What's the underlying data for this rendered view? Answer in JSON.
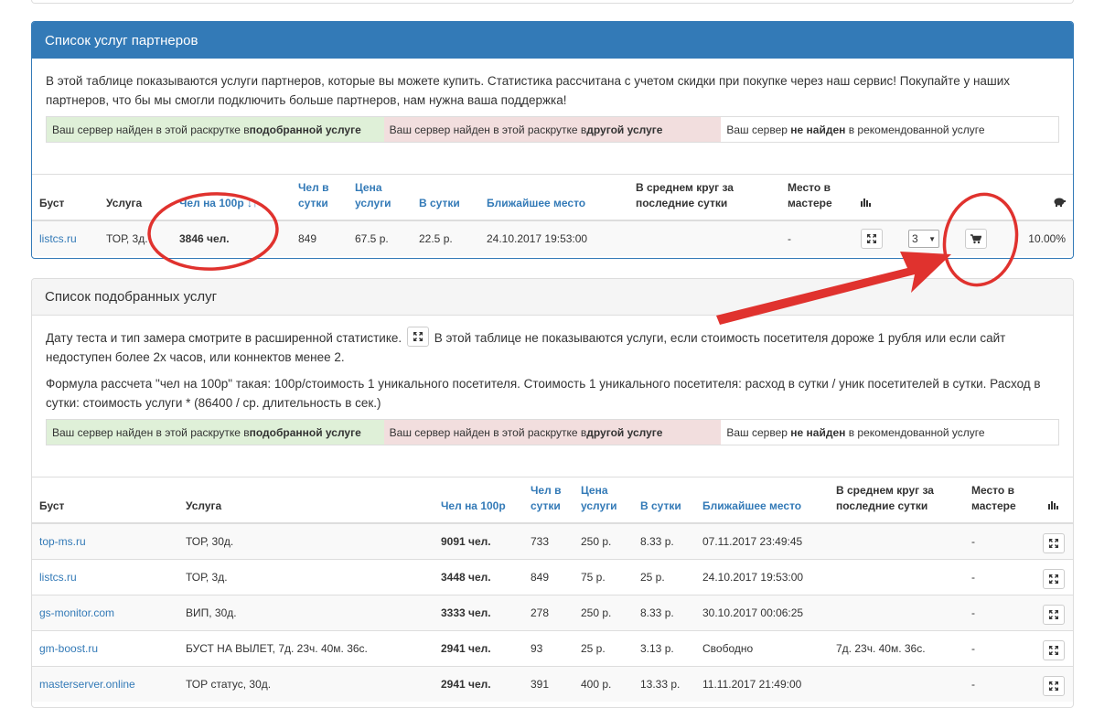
{
  "partners": {
    "title": "Список услуг партнеров",
    "description": "В этой таблице показываются услуги партнеров, которые вы можете купить. Статистика рассчитана с учетом скидки при покупке через наш сервис! Покупайте у наших партнеров, что бы мы смогли подключить больше партнеров, нам нужна ваша поддержка!",
    "legend": {
      "found_selected_prefix": "Ваш сервер найден в этой раскрутке в ",
      "found_selected_bold": "подобранной услуге",
      "found_other_prefix": "Ваш сервер найден в этой раскрутке в ",
      "found_other_bold": "другой услуге",
      "not_found_prefix": "Ваш сервер ",
      "not_found_bold": "не найден",
      "not_found_suffix": " в рекомендованной услуге"
    },
    "columns": {
      "boost": "Буст",
      "service": "Услуга",
      "per100": "Чел на 100р",
      "sort_indicator": "↓↑",
      "per_day_people": "Чел в сутки",
      "price": "Цена услуги",
      "per_day": "В сутки",
      "nearest": "Ближайшее место",
      "avg_round": "В среднем круг за последние сутки",
      "place_master": "Место в мастере",
      "stats_icon": "bar-chart-icon",
      "discount_icon": "piggy-bank-icon"
    },
    "rows": [
      {
        "boost": "listcs.ru",
        "service": "ТОР, 3д.",
        "per100": "3846 чел.",
        "per_day_people": "849",
        "price": "67.5 р.",
        "per_day": "22.5 р.",
        "nearest": "24.10.2017 19:53:00",
        "avg_round": "",
        "place_master": "-",
        "qty": "3",
        "discount": "10.00%"
      }
    ]
  },
  "selected": {
    "title": "Список подобранных услуг",
    "desc1_before": "Дату теста и тип замера смотрите в расширенной статистике.",
    "desc1_after": "В этой таблице не показываются услуги, если стоимость посетителя дороже 1 рубля или если сайт недоступен более 2х часов, или коннектов менее 2.",
    "desc2": "Формула рассчета \"чел на 100р\" такая: 100р/стоимость 1 уникального посетителя. Стоимость 1 уникального посетителя: расход в сутки / уник посетителей в сутки. Расход в сутки: стоимость услуги * (86400 / ср. длительность в сек.)",
    "columns": {
      "boost": "Буст",
      "service": "Услуга",
      "per100": "Чел на 100р",
      "per_day_people": "Чел в сутки",
      "price": "Цена услуги",
      "per_day": "В сутки",
      "nearest": "Ближайшее место",
      "avg_round": "В среднем круг за последние сутки",
      "place_master": "Место в мастере",
      "stats_icon": "bar-chart-icon"
    },
    "rows": [
      {
        "boost": "top-ms.ru",
        "service": "ТОР, 30д.",
        "per100": "9091 чел.",
        "per_day_people": "733",
        "price": "250 р.",
        "per_day": "8.33 р.",
        "nearest": "07.11.2017 23:49:45",
        "avg_round": "",
        "place_master": "-"
      },
      {
        "boost": "listcs.ru",
        "service": "ТОР, 3д.",
        "per100": "3448 чел.",
        "per_day_people": "849",
        "price": "75 р.",
        "per_day": "25 р.",
        "nearest": "24.10.2017 19:53:00",
        "avg_round": "",
        "place_master": "-"
      },
      {
        "boost": "gs-monitor.com",
        "service": "ВИП, 30д.",
        "per100": "3333 чел.",
        "per_day_people": "278",
        "price": "250 р.",
        "per_day": "8.33 р.",
        "nearest": "30.10.2017 00:06:25",
        "avg_round": "",
        "place_master": "-"
      },
      {
        "boost": "gm-boost.ru",
        "service": "БУСТ НА ВЫЛЕТ, 7д. 23ч. 40м. 36с.",
        "per100": "2941 чел.",
        "per_day_people": "93",
        "price": "25 р.",
        "per_day": "3.13 р.",
        "nearest": "Свободно",
        "avg_round": "7д. 23ч. 40м. 36с.",
        "place_master": "-"
      },
      {
        "boost": "masterserver.online",
        "service": "ТОР статус, 30д.",
        "per100": "2941 чел.",
        "per_day_people": "391",
        "price": "400 р.",
        "per_day": "13.33 р.",
        "nearest": "11.11.2017 21:49:00",
        "avg_round": "",
        "place_master": "-"
      }
    ]
  },
  "colors": {
    "primary": "#337ab7",
    "success_bg": "#dff0d8",
    "danger_bg": "#f2dede",
    "annotation_red": "#e0322e"
  }
}
